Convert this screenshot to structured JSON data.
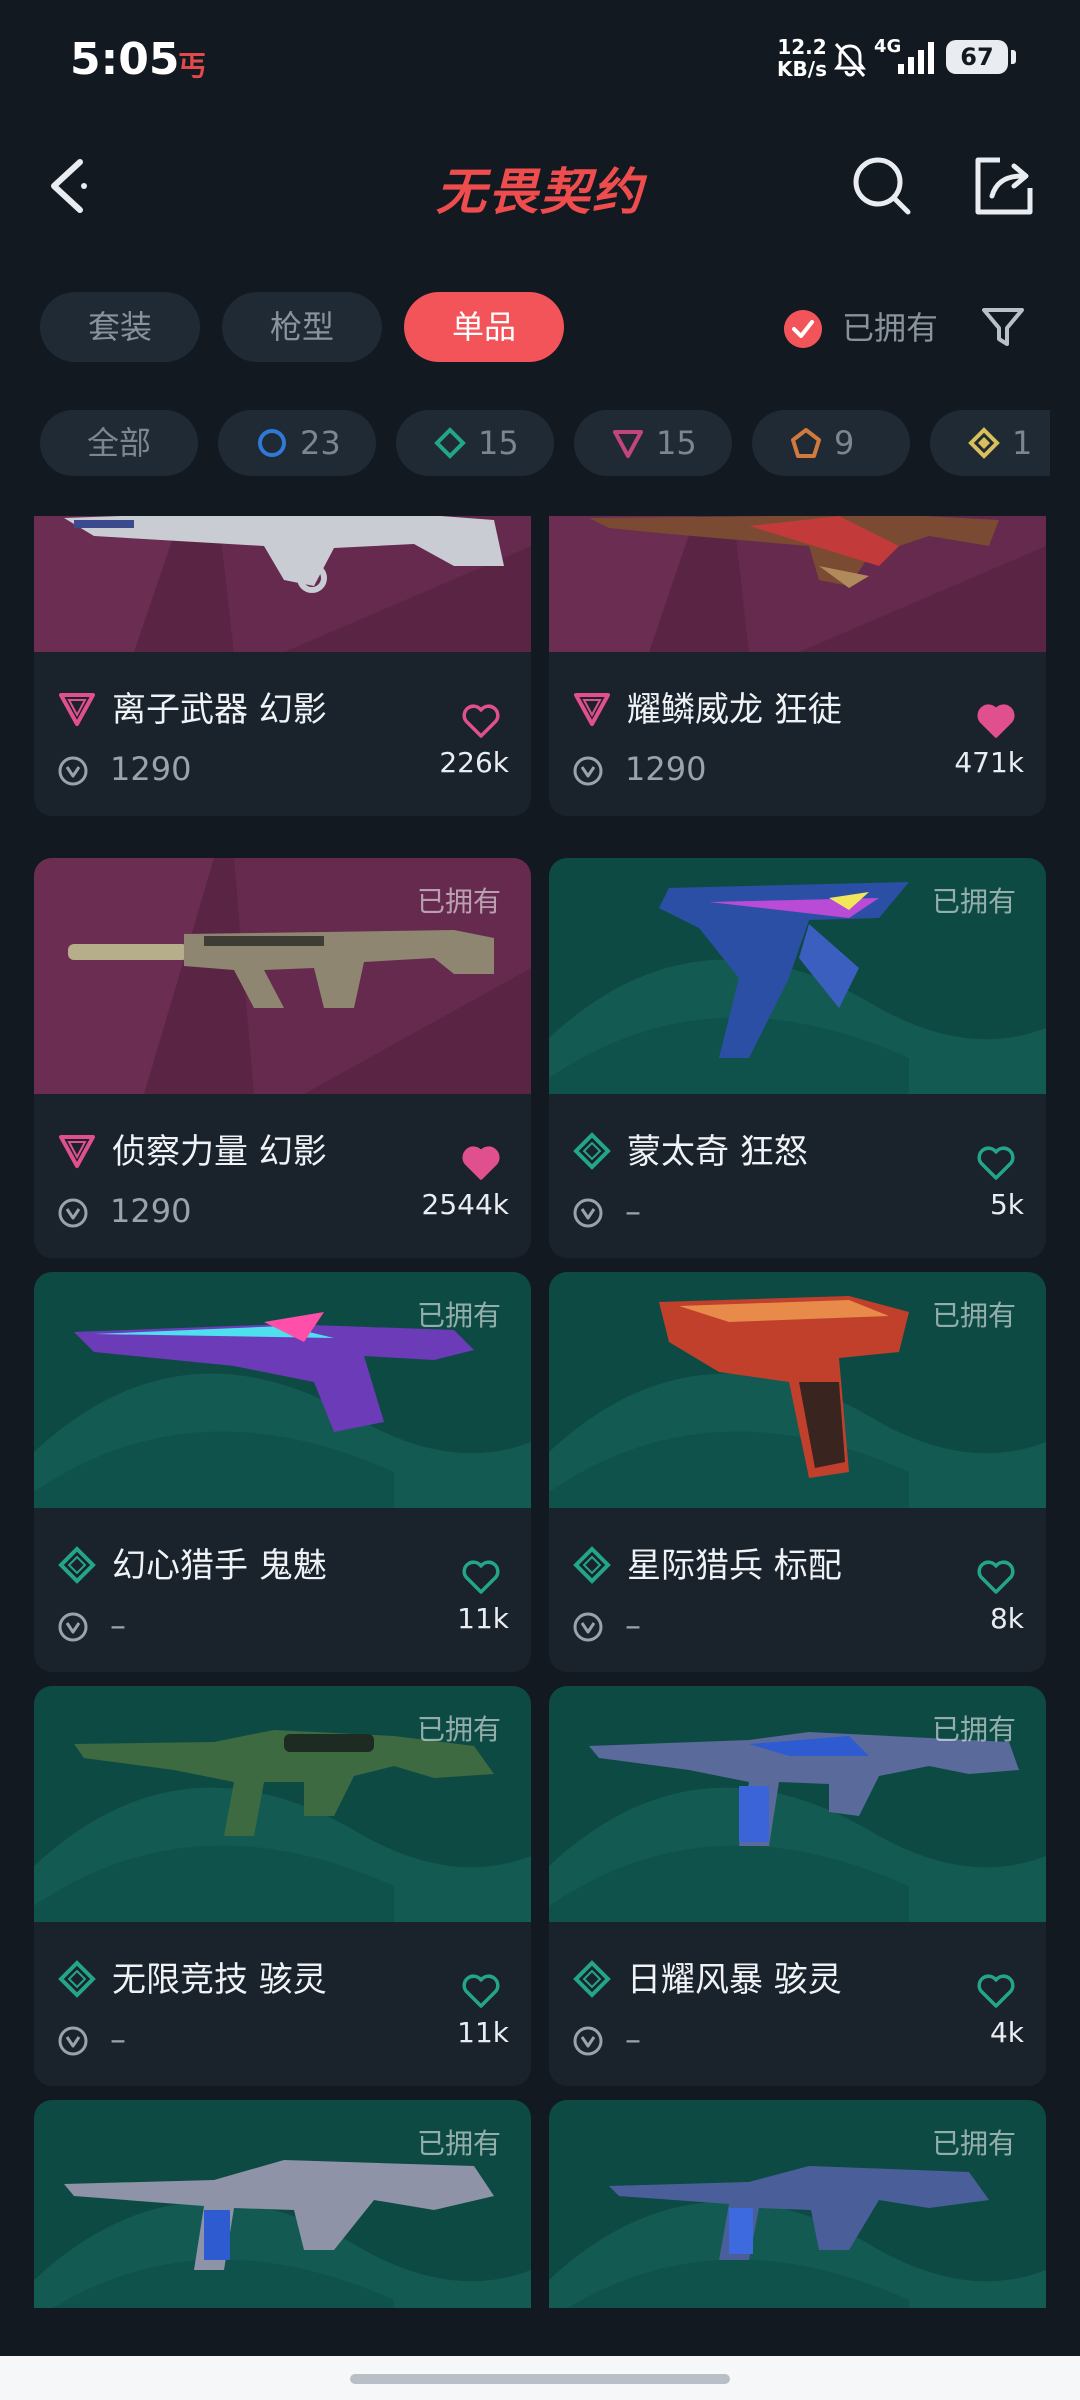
{
  "status_bar": {
    "time": "5:05",
    "app_glyph": "丐",
    "speed_value": "12.2",
    "speed_unit": "KB/s",
    "network": "4G",
    "battery": "67"
  },
  "header": {
    "title": "无畏契约"
  },
  "tabs": [
    {
      "label": "套装",
      "active": false
    },
    {
      "label": "枪型",
      "active": false
    },
    {
      "label": "单品",
      "active": true
    }
  ],
  "owned_filter": {
    "label": "已拥有",
    "checked": true
  },
  "chips": [
    {
      "label": "全部"
    },
    {
      "icon": "select-ring-icon",
      "count": "23",
      "color": "#2f7ad8"
    },
    {
      "icon": "deluxe-diamond-icon",
      "count": "15",
      "color": "#23a58a"
    },
    {
      "icon": "premium-triangle-icon",
      "count": "15",
      "color": "#c2457e"
    },
    {
      "icon": "exclusive-pentagon-icon",
      "count": "9",
      "color": "#d07a3e"
    },
    {
      "icon": "ultra-diamond-icon",
      "count": "1",
      "color": "#d8c05a"
    }
  ],
  "cards": [
    {
      "name": "离子武器 幻影",
      "price": "1290",
      "likes": "226k",
      "owned": "",
      "tier": "premium",
      "liked": false
    },
    {
      "name": "耀鳞威龙 狂徒",
      "price": "1290",
      "likes": "471k",
      "owned": "",
      "tier": "premium",
      "liked": true
    },
    {
      "name": "侦察力量 幻影",
      "price": "1290",
      "likes": "2544k",
      "owned": "已拥有",
      "tier": "premium",
      "liked": true
    },
    {
      "name": "蒙太奇 狂怒",
      "price": "–",
      "likes": "5k",
      "owned": "已拥有",
      "tier": "deluxe",
      "liked": false
    },
    {
      "name": "幻心猎手 鬼魅",
      "price": "–",
      "likes": "11k",
      "owned": "已拥有",
      "tier": "deluxe",
      "liked": false
    },
    {
      "name": "星际猎兵 标配",
      "price": "–",
      "likes": "8k",
      "owned": "已拥有",
      "tier": "deluxe",
      "liked": false
    },
    {
      "name": "无限竞技 骇灵",
      "price": "–",
      "likes": "11k",
      "owned": "已拥有",
      "tier": "deluxe",
      "liked": false
    },
    {
      "name": "日耀风暴 骇灵",
      "price": "–",
      "likes": "4k",
      "owned": "已拥有",
      "tier": "deluxe",
      "liked": false
    },
    {
      "name": "",
      "price": "",
      "likes": "",
      "owned": "已拥有",
      "tier": "deluxe",
      "liked": false
    },
    {
      "name": "",
      "price": "",
      "likes": "",
      "owned": "已拥有",
      "tier": "deluxe",
      "liked": false
    }
  ],
  "colors": {
    "accent": "#f2545a",
    "premium_pink": "#e0508e",
    "deluxe_teal": "#23a58a",
    "background": "#121921"
  }
}
